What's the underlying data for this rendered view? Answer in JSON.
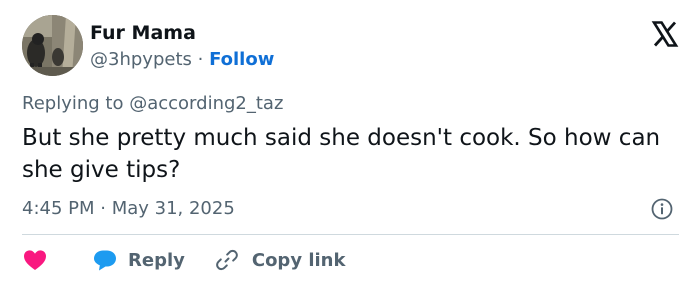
{
  "author": {
    "name": "Fur Mama",
    "handle": "@3hpypets",
    "separator": "·",
    "follow_label": "Follow"
  },
  "reply_context": {
    "prefix": "Replying to",
    "mention": "@according2_taz"
  },
  "tweet": {
    "text": "But she pretty much said she doesn't cook. So how can she give tips?",
    "timestamp": "4:45 PM · May 31, 2025"
  },
  "actions": {
    "reply_label": "Reply",
    "copy_link_label": "Copy link"
  },
  "colors": {
    "text": "#0f1419",
    "secondary": "#536471",
    "follow": "#0f6fd6",
    "like": "#f91880",
    "reply": "#1d9bf0",
    "divider": "#cfd9de"
  },
  "icons": {
    "brand": "x-logo-icon",
    "like": "heart-icon",
    "reply": "speech-bubble-icon",
    "copy_link": "link-icon",
    "info": "info-icon"
  }
}
